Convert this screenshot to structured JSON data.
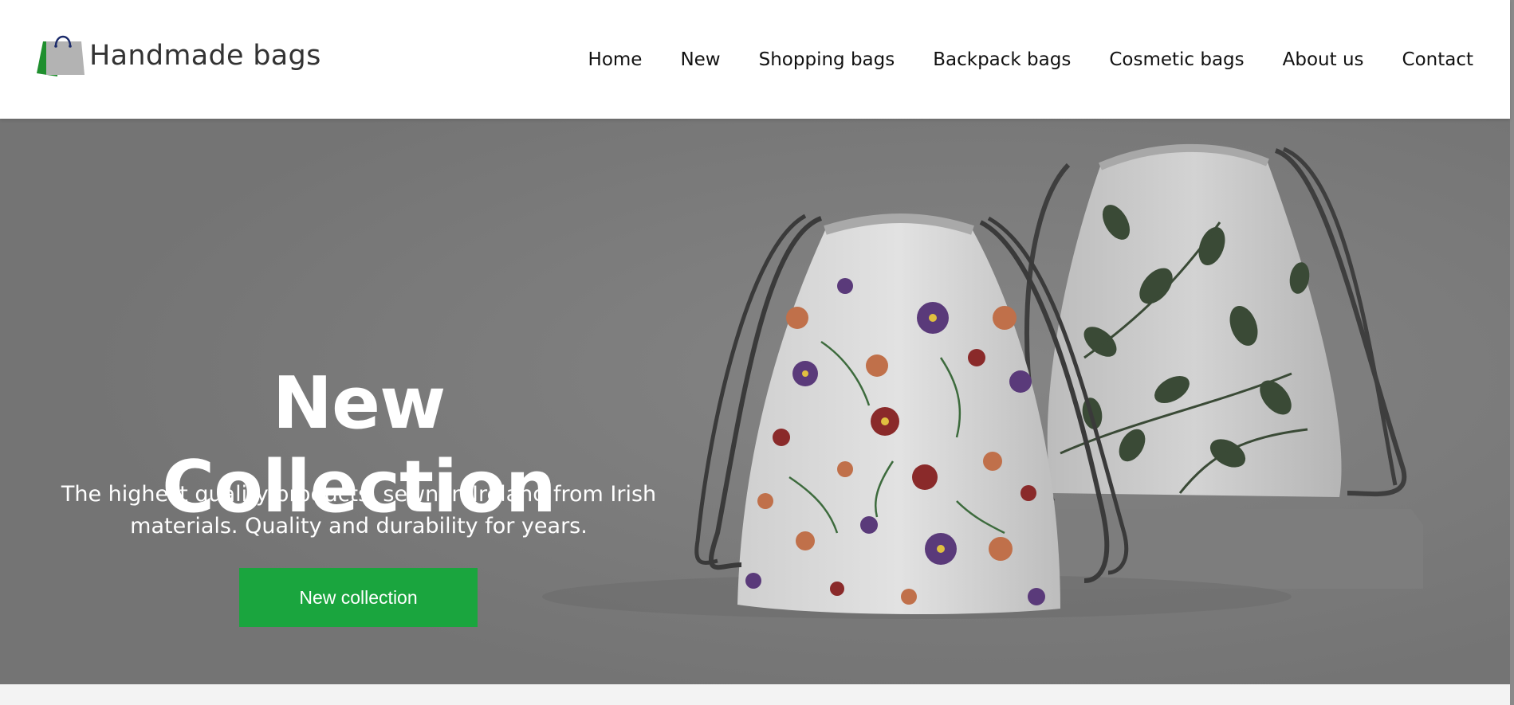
{
  "brand": {
    "name": "Handmade bags",
    "logo_icon": "shopping-bag-icon"
  },
  "nav": {
    "items": [
      {
        "label": "Home"
      },
      {
        "label": "New"
      },
      {
        "label": "Shopping bags"
      },
      {
        "label": "Backpack bags"
      },
      {
        "label": "Cosmetic bags"
      },
      {
        "label": "About us"
      },
      {
        "label": "Contact"
      }
    ]
  },
  "hero": {
    "title": "New Collection",
    "subtitle_line1": "The highest quality products, sewn in Ireland from Irish",
    "subtitle_line2": "materials. Quality and durability for years.",
    "button_label": "New collection",
    "image": "drawstring-bags-photo"
  },
  "colors": {
    "accent": "#1aa53e",
    "overlay": "#787878",
    "logo_green": "#1f8f2e",
    "logo_gray": "#b3b3b3"
  }
}
